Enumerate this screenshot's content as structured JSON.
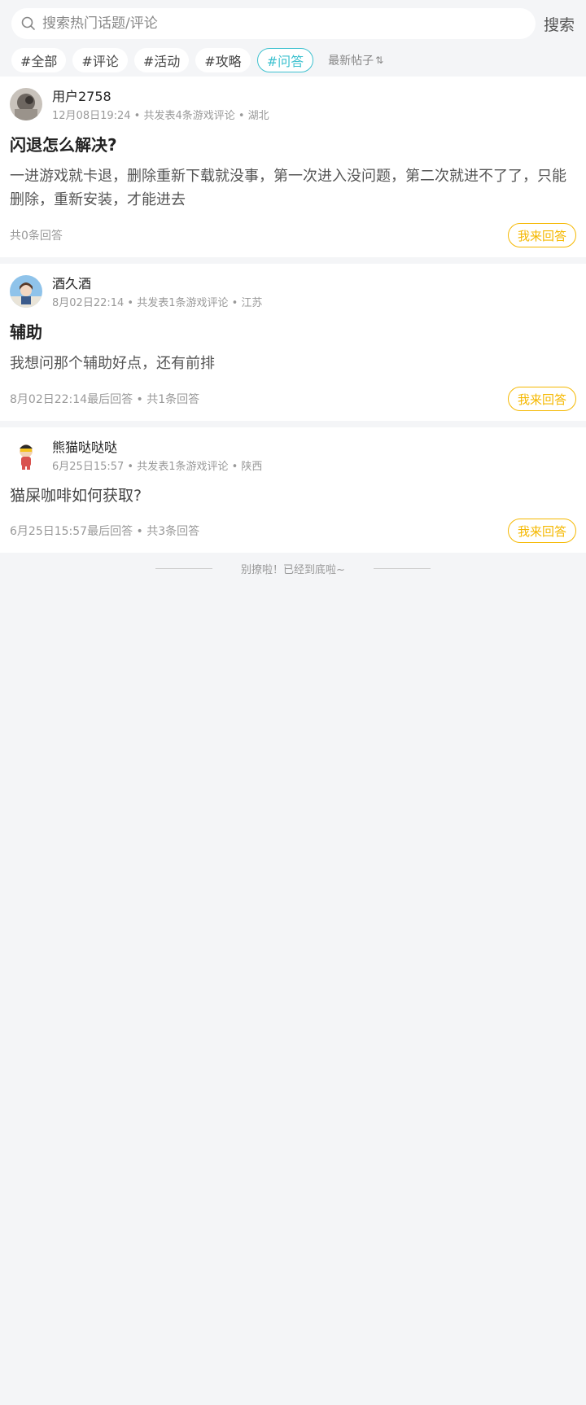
{
  "search": {
    "placeholder": "搜索热门话题/评论",
    "button_label": "搜索"
  },
  "tags": [
    "#全部",
    "#评论",
    "#活动",
    "#攻略",
    "#问答"
  ],
  "active_tag": "#问答",
  "sort_label": "最新帖子",
  "colors": {
    "accent": "#3ec1cf",
    "answer": "#f5b800",
    "background": "#f4f5f7"
  },
  "posts": [
    {
      "username": "用户2758",
      "meta": "12月08日19:24 • 共发表4条游戏评论 • 湖北",
      "title": "闪退怎么解决?",
      "body": "一进游戏就卡退，删除重新下载就没事，第一次进入没问题，第二次就进不了了，只能删除，重新安装，才能进去",
      "footer": "共0条回答",
      "answer_label": "我来回答"
    },
    {
      "username": "酒久酒",
      "meta": "8月02日22:14 • 共发表1条游戏评论 • 江苏",
      "title": "辅助",
      "body": "我想问那个辅助好点，还有前排",
      "footer": "8月02日22:14最后回答 • 共1条回答",
      "answer_label": "我来回答"
    },
    {
      "username": "熊猫哒哒哒",
      "meta": "6月25日15:57 • 共发表1条游戏评论 • 陕西",
      "title": "猫屎咖啡如何获取?",
      "footer": "6月25日15:57最后回答 • 共3条回答",
      "answer_label": "我来回答"
    }
  ],
  "end_text": "别撩啦！已经到底啦~"
}
